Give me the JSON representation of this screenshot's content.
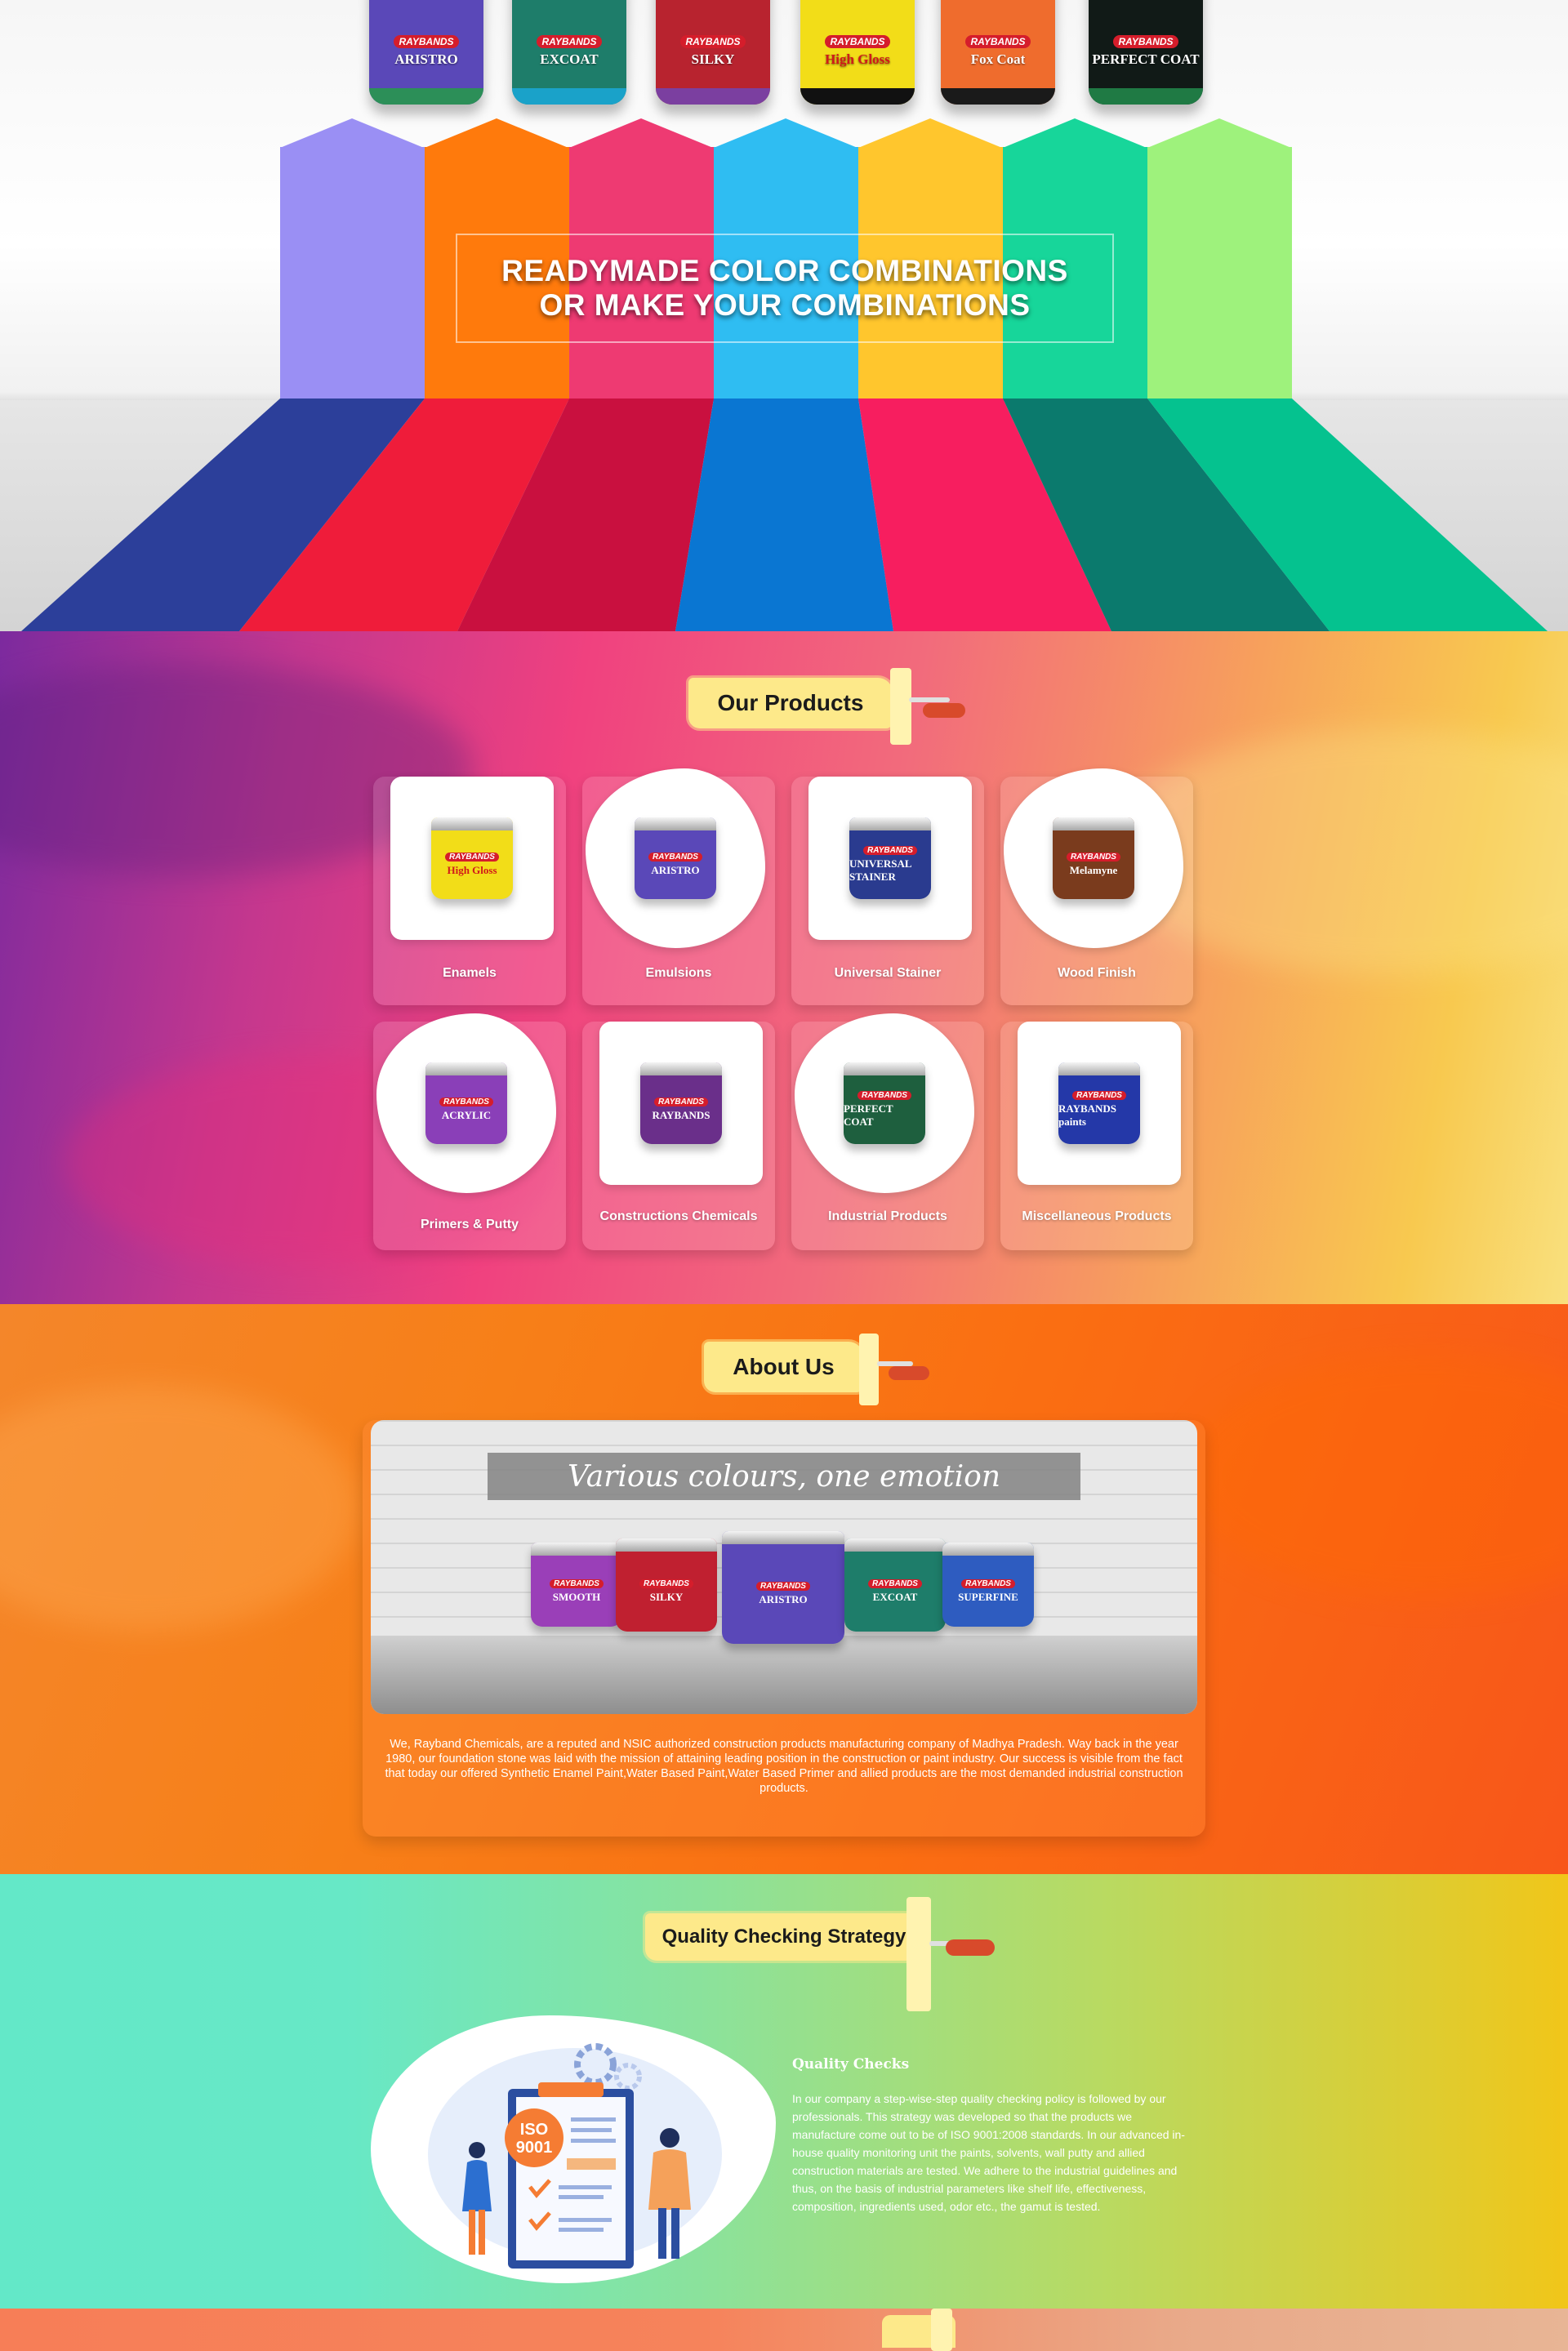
{
  "hero": {
    "headline_line1": "READYMADE COLOR COMBINATIONS",
    "headline_line2": "OR MAKE YOUR COMBINATIONS",
    "cans": [
      {
        "brand": "RAYBANDS",
        "name": "ARISTRO",
        "color": "#5a48b8",
        "band": "#2c8f58"
      },
      {
        "brand": "RAYBANDS",
        "name": "EXCOAT",
        "color": "#1e7d6a",
        "band": "#1aa2c9"
      },
      {
        "brand": "RAYBANDS",
        "name": "SILKY",
        "color": "#b8232f",
        "band": "#7b3fa0"
      },
      {
        "brand": "RAYBANDS",
        "name": "High Gloss",
        "color": "#f2dd18",
        "band": "#111111"
      },
      {
        "brand": "RAYBANDS",
        "name": "Fox Coat",
        "color": "#ef6c2d",
        "band": "#1a1a1a"
      },
      {
        "brand": "RAYBANDS",
        "name": "PERFECT COAT",
        "color": "#111a17",
        "band": "#1f7a44"
      }
    ],
    "stripe_colors": [
      "#9a8ff4",
      "#ff7a0c",
      "#ee3a72",
      "#2fbdf2",
      "#ffc62d",
      "#17d69a",
      "#9ef27c"
    ],
    "floor_colors": [
      "#2c3f9a",
      "#ef1c3a",
      "#c9103f",
      "#0a76d2",
      "#f71e5f",
      "#0b7a6d",
      "#05c28f"
    ]
  },
  "products": {
    "heading": "Our Products",
    "items": [
      {
        "label": "Enamels",
        "can_name": "High Gloss",
        "can_color": "#f2dd18",
        "shape": "square"
      },
      {
        "label": "Emulsions",
        "can_name": "ARISTRO",
        "can_color": "#5a48b8",
        "shape": "blob"
      },
      {
        "label": "Universal Stainer",
        "can_name": "UNIVERSAL STAINER",
        "can_color": "#2a3b8f",
        "shape": "square"
      },
      {
        "label": "Wood Finish",
        "can_name": "Melamyne",
        "can_color": "#7a3b1d",
        "shape": "blob"
      },
      {
        "label": "Primers & Putty",
        "can_name": "ACRYLIC",
        "can_color": "#8a3fb8",
        "shape": "blob"
      },
      {
        "label": "Constructions Chemicals",
        "can_name": "RAYBANDS",
        "can_color": "#6a2f8a",
        "shape": "square"
      },
      {
        "label": "Industrial Products",
        "can_name": "PERFECT COAT",
        "can_color": "#1e5f3e",
        "shape": "blob"
      },
      {
        "label": "Miscellaneous Products",
        "can_name": "RAYBANDS paints",
        "can_color": "#2438a8",
        "shape": "square"
      }
    ]
  },
  "about": {
    "heading": "About Us",
    "banner": "Various colours, one emotion",
    "cans": [
      "SMOOTH",
      "SILKY",
      "ARISTRO",
      "EXCOAT",
      "SUPERFINE"
    ],
    "can_colors": [
      "#9a3fb8",
      "#c02030",
      "#5a48b8",
      "#1e7d6a",
      "#2e5cc0"
    ],
    "text": "We, Rayband Chemicals, are a reputed and NSIC authorized construction products manufacturing company of Madhya Pradesh. Way back in the year 1980, our foundation stone was laid with the mission of attaining leading position in the construction or paint industry. Our success is visible from the fact that today our offered Synthetic Enamel Paint,Water Based Paint,Water Based Primer and allied products are the most demanded industrial construction products."
  },
  "quality": {
    "heading": "Quality Checking Strategy",
    "subtitle": "Quality Checks",
    "badge_line1": "ISO",
    "badge_line2": "9001",
    "text": "In our company a step-wise-step quality checking policy is followed by our professionals. This strategy was developed so that the products we manufacture come out to be of ISO 9001:2008 standards. In our advanced in-house quality monitoring unit the paints, solvents, wall putty and allied construction materials are tested. We adhere to the industrial guidelines and thus, on the basis of industrial parameters like shelf life, effectiveness, composition, ingredients used, odor etc., the gamut is tested."
  }
}
